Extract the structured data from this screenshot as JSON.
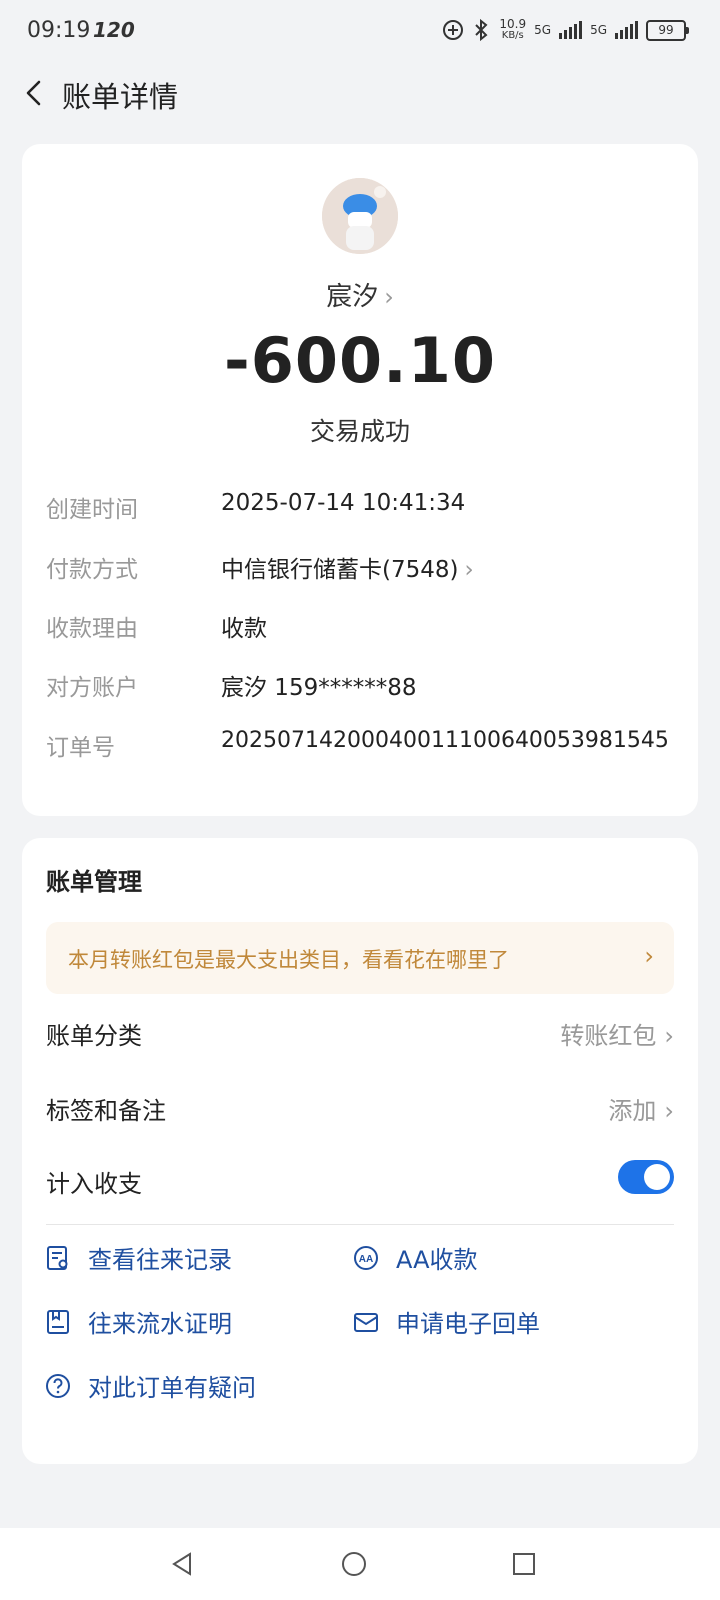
{
  "status_bar": {
    "time": "09:19",
    "refresh": "120",
    "net_speed_top": "10.9",
    "net_speed_unit": "KB/s",
    "signal1": "5G",
    "signal2": "5G",
    "battery": "99"
  },
  "header": {
    "title": "账单详情"
  },
  "payee": {
    "name": "宸汐",
    "amount": "-600.10",
    "status": "交易成功"
  },
  "details": [
    {
      "label": "创建时间",
      "value": "2025-07-14 10:41:34"
    },
    {
      "label": "付款方式",
      "value": "中信银行储蓄卡(7548)"
    },
    {
      "label": "收款理由",
      "value": "收款"
    },
    {
      "label": "对方账户",
      "value": "宸汐 159******88"
    },
    {
      "label": "订单号",
      "value": "2025071420004001110064005398​1545"
    }
  ],
  "management": {
    "title": "账单管理",
    "tip": "本月转账红包是最大支出类目，看看花在哪里了",
    "category_label": "账单分类",
    "category_value": "转账红包",
    "tags_label": "标签和备注",
    "tags_value": "添加",
    "count_label": "计入收支",
    "count_enabled": true
  },
  "actions": [
    {
      "label": "查看往来记录",
      "icon": "records-icon"
    },
    {
      "label": "AA收款",
      "icon": "aa-icon"
    },
    {
      "label": "往来流水证明",
      "icon": "certificate-icon"
    },
    {
      "label": "申请电子回单",
      "icon": "mail-icon"
    },
    {
      "label": "对此订单有疑问",
      "icon": "question-icon"
    }
  ],
  "colors": {
    "accent": "#1e73e8",
    "link": "#1f4fa0",
    "tip": "#c0883a"
  }
}
